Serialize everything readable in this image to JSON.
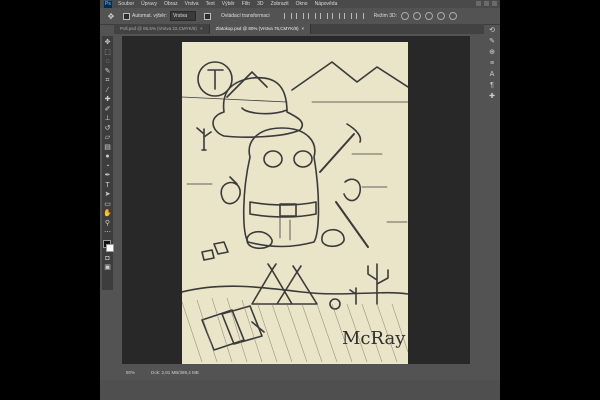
{
  "menubar": {
    "logo": "Ps",
    "items": [
      "Soubor",
      "Úpravy",
      "Obraz",
      "Vrstva",
      "Text",
      "Výběr",
      "Filtr",
      "3D",
      "Zobrazit",
      "Okno",
      "Nápověda"
    ]
  },
  "options": {
    "auto_select_label": "Automat. výběr:",
    "auto_select_value": "Vrstva",
    "transform_label": "Ovládací transformaci",
    "mode_3d_label": "Režim 3D:"
  },
  "tabs": [
    {
      "label": "Poll.psd @ 85,5% (Vrstva 22,CMYK/8)",
      "active": false
    },
    {
      "label": "Zlatokop.psd @ 80% (Vrstva 76,CMYK/8)",
      "active": true
    }
  ],
  "tools": [
    "move-tool-icon",
    "marquee-tool-icon",
    "lasso-tool-icon",
    "quick-select-tool-icon",
    "crop-tool-icon",
    "eyedropper-tool-icon",
    "healing-brush-tool-icon",
    "brush-tool-icon",
    "clone-stamp-tool-icon",
    "history-brush-tool-icon",
    "eraser-tool-icon",
    "gradient-tool-icon",
    "blur-tool-icon",
    "dodge-tool-icon",
    "pen-tool-icon",
    "type-tool-icon",
    "path-selection-tool-icon",
    "shape-tool-icon",
    "hand-tool-icon",
    "zoom-tool-icon",
    "more-tools-icon"
  ],
  "artwork": {
    "signature": "McRay"
  },
  "status": {
    "zoom": "80%",
    "doc_size": "Dok: 2,91 MB/389,4 MB"
  },
  "colors": {
    "app_bg": "#535353",
    "canvas_paper": "#eae4c8",
    "workspace": "#282828",
    "ink": "#3a3a3a"
  }
}
